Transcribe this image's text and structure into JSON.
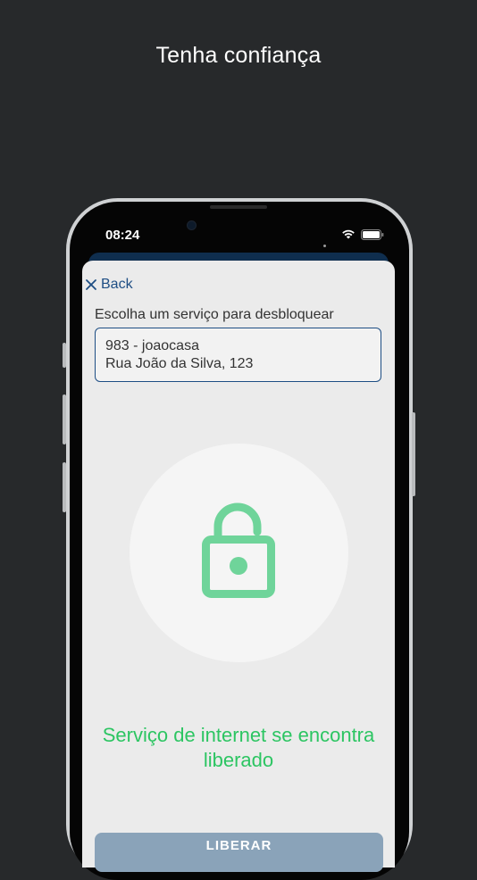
{
  "headline": "Tenha confiança",
  "status_bar": {
    "time": "08:24"
  },
  "nav": {
    "back_label": "Back"
  },
  "form": {
    "label": "Escolha um serviço para desbloquear",
    "selected_service": {
      "line1": "983 - joaocasa",
      "line2": "Rua João da Silva, 123"
    }
  },
  "lock": {
    "icon": "unlocked-padlock-icon",
    "state": "unlocked"
  },
  "status_message": "Serviço de internet se encontra liberado",
  "action_button": {
    "label": "LIBERAR"
  },
  "colors": {
    "background": "#27292b",
    "accent_blue": "#1e4e84",
    "header_band": "#0f2e4e",
    "success_green": "#2cc562",
    "lock_green": "#6fd49a",
    "button_disabled": "#8aa3b9"
  }
}
